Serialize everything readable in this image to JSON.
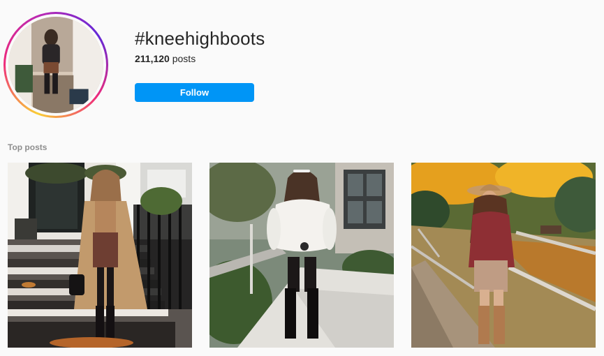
{
  "hashtag": {
    "title": "#kneehighboots",
    "post_count": "211,120",
    "post_count_suffix": " posts",
    "follow_label": "Follow"
  },
  "section": {
    "top_posts_label": "Top posts"
  },
  "colors": {
    "follow_button": "#0095f6",
    "muted_label": "#8e8e8e",
    "page_background": "#fafafa"
  },
  "posts": [
    {
      "scene": "woman in camel coat and plaid skirt on tiled stoop"
    },
    {
      "scene": "woman in white sweater and black knee-high boots on path"
    },
    {
      "scene": "woman in felt hat, red top and plaid skirt in autumn park"
    }
  ]
}
